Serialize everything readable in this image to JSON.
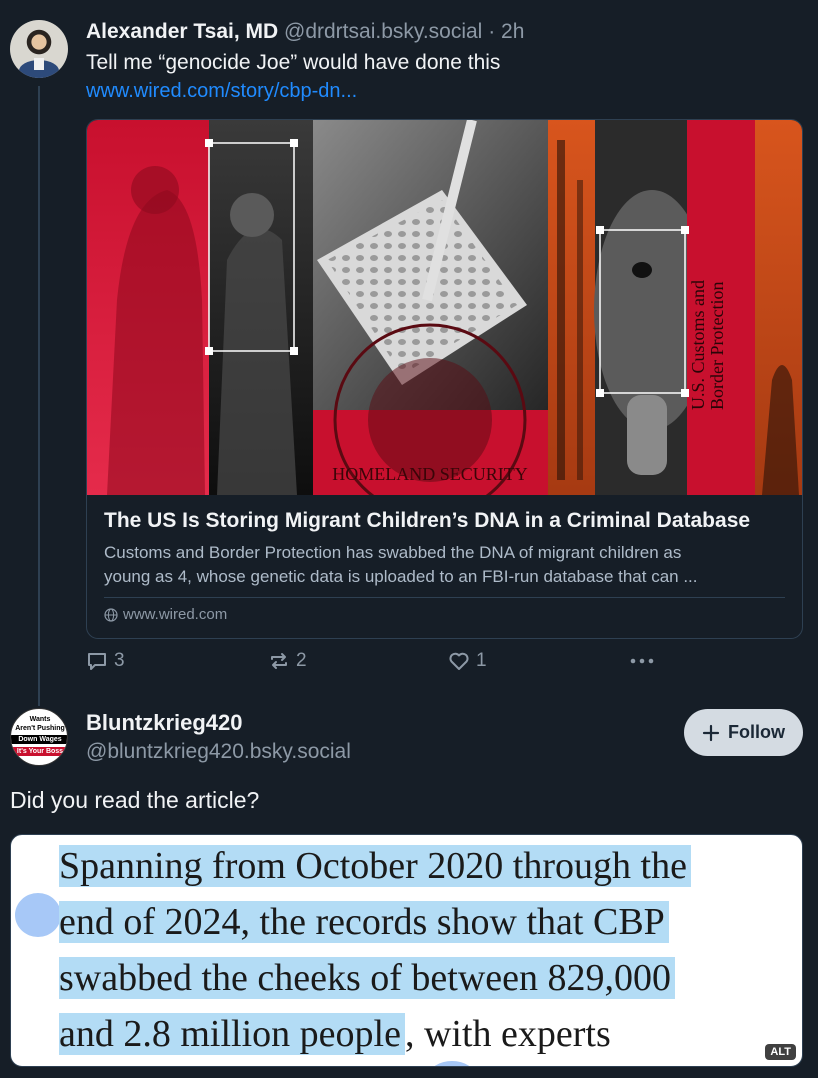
{
  "post1": {
    "author_name": "Alexander Tsai, MD",
    "handle": "@drdrtsai.bsky.social",
    "separator": "·",
    "time": "2h",
    "text": "Tell me “genocide Joe” would have done this",
    "link_text": "www.wired.com/story/cbp-dn...",
    "card": {
      "image_texts": {
        "seal_text": "HOMELAND SECURITY",
        "banner_text_1": "U.S. Customs and",
        "banner_text_2": "Border Protection"
      },
      "title": "The US Is Storing Migrant Children’s DNA in a Criminal Database",
      "description_line1": "Customs and Border Protection has swabbed the DNA of migrant children as",
      "description_line2": "young as 4, whose genetic data is uploaded to an FBI-run database that can ...",
      "domain": "www.wired.com"
    },
    "actions": {
      "reply_count": "3",
      "repost_count": "2",
      "like_count": "1",
      "more_icon": "more-icon"
    }
  },
  "post2": {
    "avatar_lines": [
      "Wants",
      "Aren't Pushing",
      "Down Wages",
      "It's Your Boss"
    ],
    "author_name": "Bluntzkrieg420",
    "handle": "@bluntzkrieg420.bsky.social",
    "follow_label": "Follow",
    "text": "Did you read the article?",
    "quote_image": {
      "lines": [
        "Spanning from October 2020 through the",
        "end of 2024, the records show that CBP",
        "swabbed the cheeks of between 829,000",
        "and 2.8 million people"
      ],
      "line4_tail": ", with experts",
      "alt_label": "ALT"
    }
  },
  "colors": {
    "background": "#161e27",
    "link": "#208bfe",
    "muted": "#8d99a6",
    "highlight": "#b3dcf5"
  }
}
